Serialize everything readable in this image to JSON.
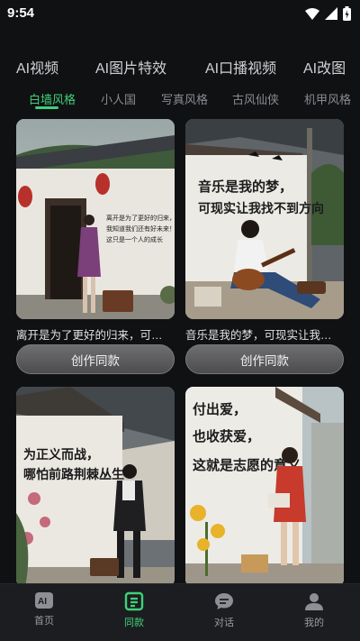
{
  "status": {
    "time": "9:54"
  },
  "main_tabs": [
    "AI视频",
    "AI图片特效",
    "AI口播视频",
    "AI改图"
  ],
  "sub_tabs": [
    "白墙风格",
    "小人国",
    "写真风格",
    "古风仙侠",
    "机甲风格"
  ],
  "active_sub_tab": "白墙风格",
  "cards": [
    {
      "caption": "离开是为了更好的归来，可…",
      "button": "创作同款",
      "wall_text": [
        "离开是为了更好的归来，",
        "我知道我们还有好未来！",
        "这只是一个人的成长"
      ]
    },
    {
      "caption": "音乐是我的梦，可现实让我…",
      "button": "创作同款",
      "wall_text": [
        "音乐是我的梦，",
        "可现实让我找不到方向"
      ]
    },
    {
      "caption": "",
      "button": "",
      "wall_text": [
        "为正义而战，",
        "哪怕前路荆棘丛生"
      ]
    },
    {
      "caption": "",
      "button": "",
      "wall_text": [
        "付出爱，",
        "也收获爱，",
        "这就是志愿的意义"
      ]
    }
  ],
  "bottom_nav": [
    {
      "label": "首页",
      "icon": "ai-home-icon"
    },
    {
      "label": "同款",
      "icon": "template-icon"
    },
    {
      "label": "对话",
      "icon": "chat-icon"
    },
    {
      "label": "我的",
      "icon": "profile-icon"
    }
  ],
  "colors": {
    "accent": "#3ed178",
    "background": "#101113"
  }
}
